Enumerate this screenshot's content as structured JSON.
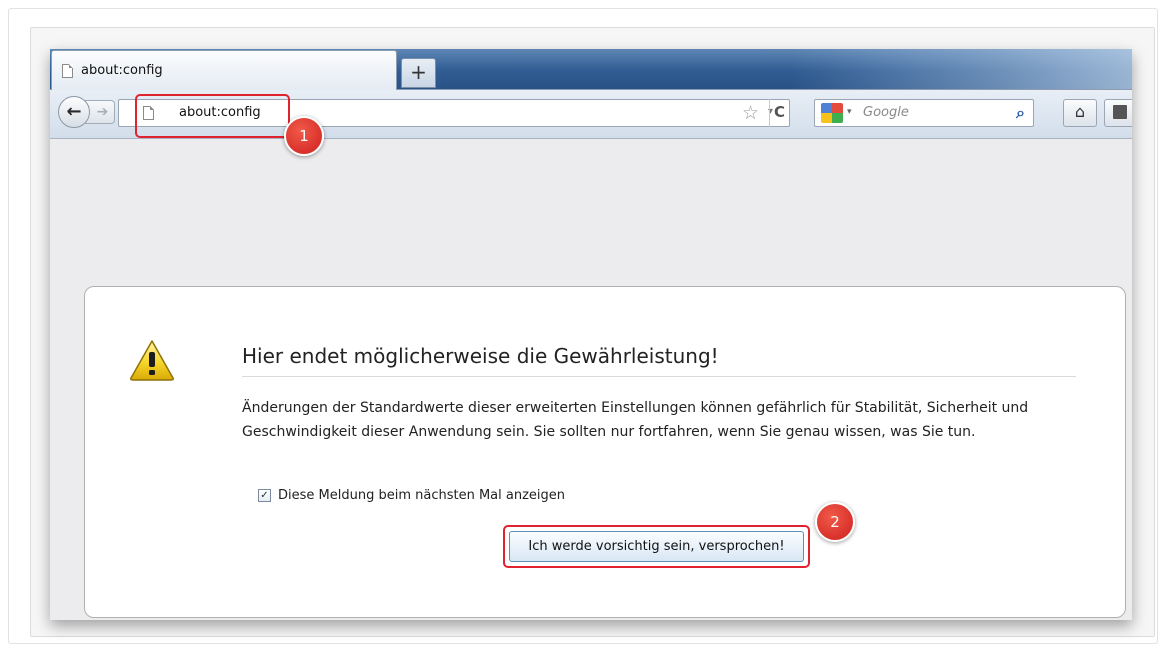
{
  "browser": {
    "tab": {
      "label": "about:config"
    },
    "new_tab_label": "+",
    "url": "about:config",
    "search": {
      "placeholder": "Google"
    }
  },
  "warning": {
    "title": "Hier endet möglicherweise die Gewährleistung!",
    "body": "Änderungen der Standardwerte dieser erweiterten Einstellungen können gefährlich für Stabilität, Sicherheit und Geschwindigkeit dieser Anwendung sein. Sie sollten nur fortfahren, wenn Sie genau wissen, was Sie tun.",
    "checkbox_label": "Diese Meldung beim nächsten Mal anzeigen",
    "checkbox_checked": true,
    "button_label": "Ich werde vorsichtig sein, versprochen!"
  },
  "annotations": {
    "badge1": "1",
    "badge2": "2",
    "highlight_color": "#e0232e"
  },
  "icons": [
    "page-icon",
    "back-arrow-icon",
    "forward-arrow-icon",
    "star-icon",
    "reload-icon",
    "google-icon",
    "search-icon",
    "home-icon",
    "bookmarks-icon",
    "warning-icon",
    "checkmark-icon"
  ]
}
